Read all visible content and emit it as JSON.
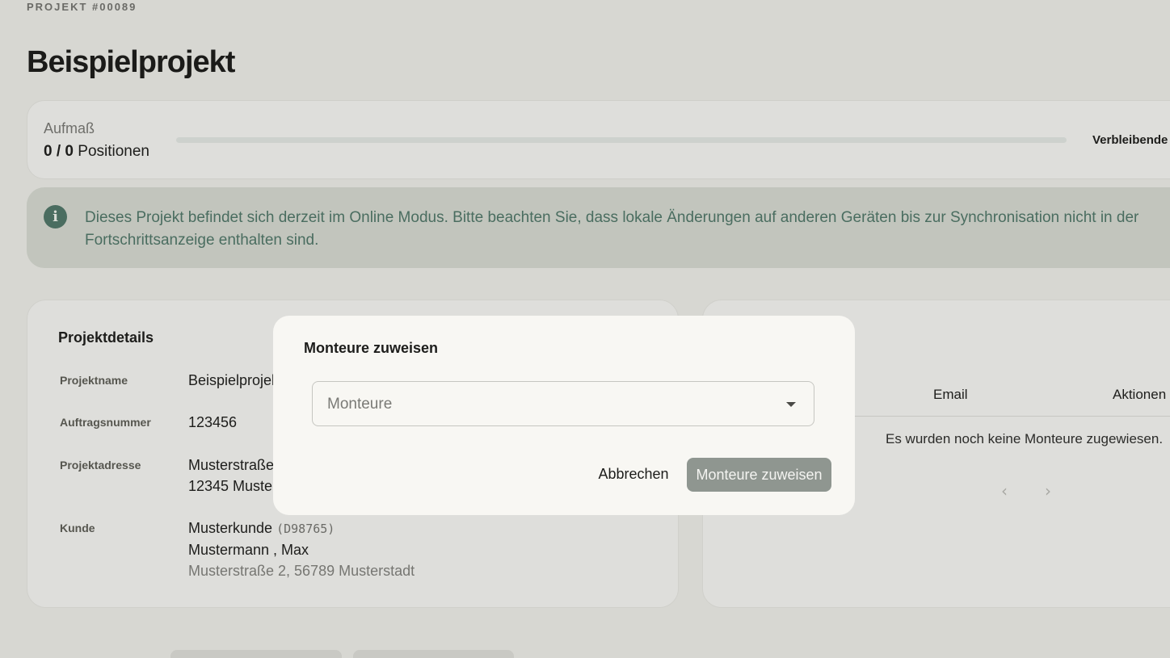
{
  "header": {
    "project_number": "PROJEKT #00089",
    "title": "Beispielprojekt"
  },
  "progress": {
    "label": "Aufmaß",
    "count": "0 / 0",
    "count_suffix": "Positionen",
    "fraction": 0,
    "remaining_label": "Verbleibende"
  },
  "info_banner": {
    "icon": "info-icon",
    "text": "Dieses Projekt befindet sich derzeit im Online Modus. Bitte beachten Sie, dass lokale Änderungen auf anderen Geräten bis zur Synchronisation nicht in der Fortschrittsanzeige enthalten sind."
  },
  "details": {
    "title": "Projektdetails",
    "project_name_label": "Projektname",
    "project_name": "Beispielprojekt",
    "order_number_label": "Auftragsnummer",
    "order_number": "123456",
    "address_label": "Projektadresse",
    "address_line1": "Musterstraße 1",
    "address_line2": "12345 Musterstadt",
    "customer_label": "Kunde",
    "customer_name": "Musterkunde",
    "customer_code": "(D98765)",
    "customer_contact": "Mustermann , Max",
    "customer_address": "Musterstraße 2, 56789 Musterstadt"
  },
  "assignees": {
    "col_email": "Email",
    "col_actions": "Aktionen",
    "empty_message": "Es wurden noch keine Monteure zugewiesen.",
    "prev_icon": "chevron-left-icon",
    "next_icon": "chevron-right-icon"
  },
  "modal": {
    "title": "Monteure zuweisen",
    "select_placeholder": "Monteure",
    "cancel_label": "Abbrechen",
    "confirm_label": "Monteure zuweisen"
  },
  "colors": {
    "accent": "#4a6d60",
    "background": "#d7d7d2",
    "modal_bg": "#f8f7f3",
    "confirm_button": "#8f9690"
  }
}
